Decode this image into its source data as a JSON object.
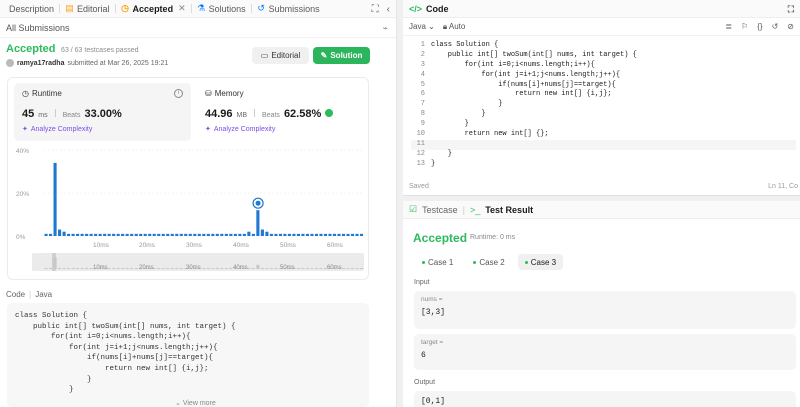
{
  "left": {
    "tabs": [
      {
        "label": "Description",
        "icon": "description-icon"
      },
      {
        "label": "Editorial",
        "icon": "book-icon"
      },
      {
        "label": "Accepted",
        "icon": "clock-icon"
      },
      {
        "label": "Solutions",
        "icon": "flask-icon"
      },
      {
        "label": "Submissions",
        "icon": "history-icon"
      }
    ],
    "subheader": "All Submissions",
    "verdict": "Accepted",
    "testcases": "63 / 63 testcases passed",
    "author": "ramya17radha",
    "submitted": "submitted at Mar 26, 2025 19:21",
    "editorial_btn": "Editorial",
    "solution_btn": "Solution",
    "runtime": {
      "label": "Runtime",
      "value": "45",
      "unit": "ms",
      "beats_label": "Beats",
      "beats": "33.00%",
      "analyze": "Analyze Complexity"
    },
    "memory": {
      "label": "Memory",
      "value": "44.96",
      "unit": "MB",
      "beats_label": "Beats",
      "beats": "62.58%",
      "analyze": "Analyze Complexity"
    },
    "code_label": "Code",
    "code_lang": "Java",
    "code": "class Solution {\n    public int[] twoSum(int[] nums, int target) {\n        for(int i=0;i<nums.length;i++){\n            for(int j=i+1;j<nums.length;j++){\n                if(nums[i]+nums[j]==target){\n                    return new int[] {i,j};\n                }\n            }",
    "view_more": "View more"
  },
  "chart_data": {
    "type": "bar",
    "title": "",
    "ylabel": "",
    "xlabel": "",
    "y_ticks": [
      "40%",
      "20%",
      "0%"
    ],
    "x_ticks": [
      "10ms",
      "20ms",
      "30ms",
      "40ms",
      "50ms",
      "60ms"
    ],
    "brush_ticks": [
      "10ms",
      "20ms",
      "30ms",
      "40ms",
      "50ms",
      "60ms"
    ],
    "ylim": [
      0,
      40
    ],
    "highlight_runtime_ms": 45,
    "values": [
      1,
      1,
      34,
      3,
      2,
      1,
      1,
      1,
      1,
      1,
      1,
      1,
      1,
      1,
      1,
      1,
      1,
      1,
      1,
      1,
      1,
      1,
      1,
      1,
      1,
      1,
      1,
      1,
      1,
      1,
      1,
      1,
      1,
      1,
      1,
      1,
      1,
      1,
      1,
      1,
      1,
      1,
      1,
      1,
      1,
      2,
      1,
      12,
      3,
      2,
      1,
      1,
      1,
      1,
      1,
      1,
      1,
      1,
      1,
      1,
      1,
      1,
      1,
      1,
      1,
      1,
      1,
      1,
      1,
      1,
      1
    ]
  },
  "editor": {
    "title": "Code",
    "language": "Java",
    "mode": "Auto",
    "lines": [
      "class Solution {",
      "    public int[] twoSum(int[] nums, int target) {",
      "        for(int i=0;i<nums.length;i++){",
      "            for(int j=i+1;j<nums.length;j++){",
      "                if(nums[i]+nums[j]==target){",
      "                    return new int[] {i,j};",
      "                }",
      "            }",
      "        }",
      "        return new int[] {};",
      "",
      "    }",
      "}"
    ],
    "line_numbers": [
      "1",
      "2",
      "3",
      "4",
      "5",
      "6",
      "7",
      "8",
      "9",
      "10",
      "11",
      "12",
      "13"
    ],
    "status": "Saved",
    "cursor": "Ln 11, Co"
  },
  "tests": {
    "tab_testcase": "Testcase",
    "tab_result": "Test Result",
    "verdict": "Accepted",
    "runtime": "Runtime: 0 ms",
    "cases": [
      "Case 1",
      "Case 2",
      "Case 3"
    ],
    "input_label": "Input",
    "inputs": [
      {
        "name": "nums =",
        "value": "[3,3]"
      },
      {
        "name": "target =",
        "value": "6"
      }
    ],
    "output_label": "Output",
    "output": "[0,1]"
  }
}
